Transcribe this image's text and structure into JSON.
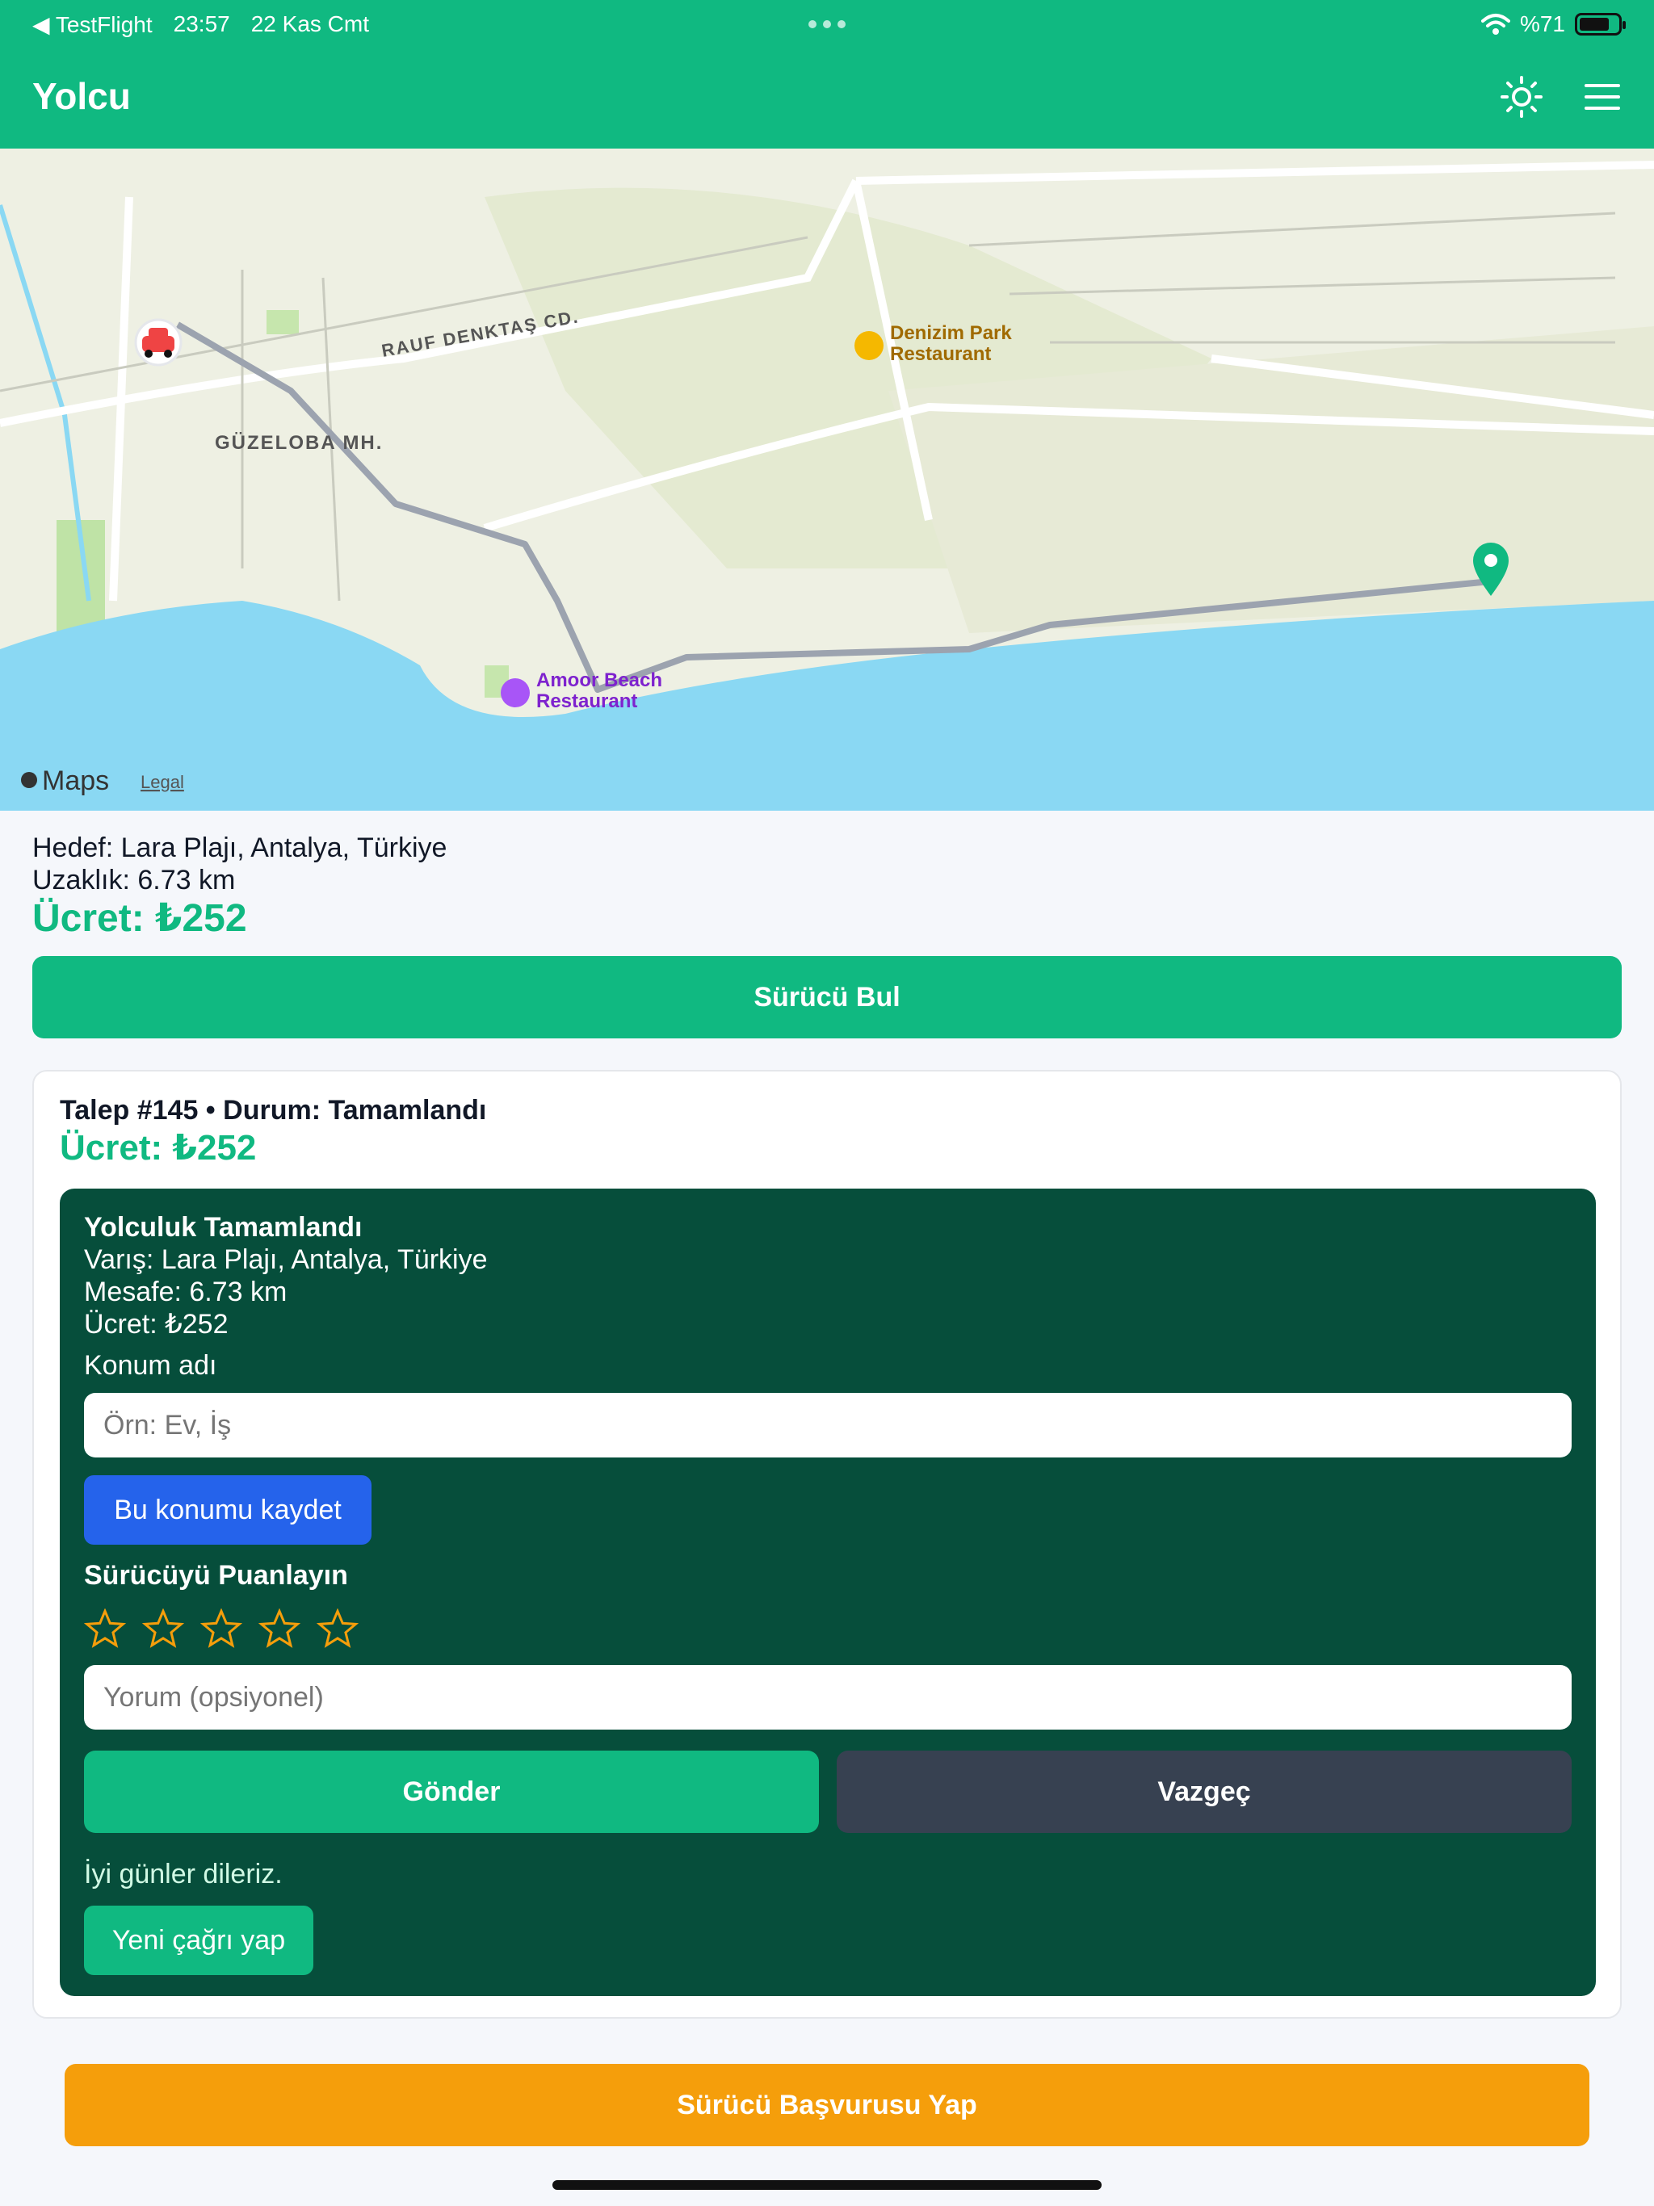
{
  "status_bar": {
    "back_app": "TestFlight",
    "time": "23:57",
    "date": "22 Kas Cmt",
    "battery_text": "%71"
  },
  "header": {
    "title": "Yolcu",
    "theme_icon": "sun-icon",
    "menu_icon": "hamburger-menu-icon"
  },
  "map": {
    "labels": {
      "street": "RAUF DENKTAŞ CD.",
      "district": "GÜZELOBA MH.",
      "poi1_line1": "Denizim Park",
      "poi1_line2": "Restaurant",
      "poi2_line1": "Amoor Beach",
      "poi2_line2": "Restaurant",
      "attribution": "Maps",
      "legal": "Legal"
    },
    "colors": {
      "land": "#eef0e3",
      "water": "#8ad8f3",
      "route": "#9ca3af",
      "pin": "#10b981"
    }
  },
  "trip": {
    "destination": "Hedef: Lara Plajı, Antalya, Türkiye",
    "distance": "Uzaklık: 6.73 km",
    "fare": "Ücret: ₺252",
    "find_driver_label": "Sürücü Bul"
  },
  "request_card": {
    "title": "Talep #145 • Durum: Tamamlandı",
    "fare": "Ücret: ₺252",
    "completed": {
      "heading": "Yolculuk Tamamlandı",
      "arrival": "Varış: Lara Plajı, Antalya, Türkiye",
      "distance": "Mesafe: 6.73 km",
      "fare": "Ücret: ₺252",
      "location_name_label": "Konum adı",
      "location_name_placeholder": "Örn: Ev, İş",
      "save_location_label": "Bu konumu kaydet",
      "rate_driver_label": "Sürücüyü Puanlayın",
      "rating_value": 0,
      "rating_max": 5,
      "comment_placeholder": "Yorum (opsiyonel)",
      "send_label": "Gönder",
      "cancel_label": "Vazgeç",
      "goodbye": "İyi günler dileriz.",
      "new_call_label": "Yeni çağrı yap"
    }
  },
  "driver_apply_label": "Sürücü Başvurusu Yap",
  "colors": {
    "primary": "#10b981",
    "dark_panel": "#064e3b",
    "blue": "#2563eb",
    "amber": "#f59e0b",
    "slate": "#374151",
    "star": "#f59e0b"
  }
}
